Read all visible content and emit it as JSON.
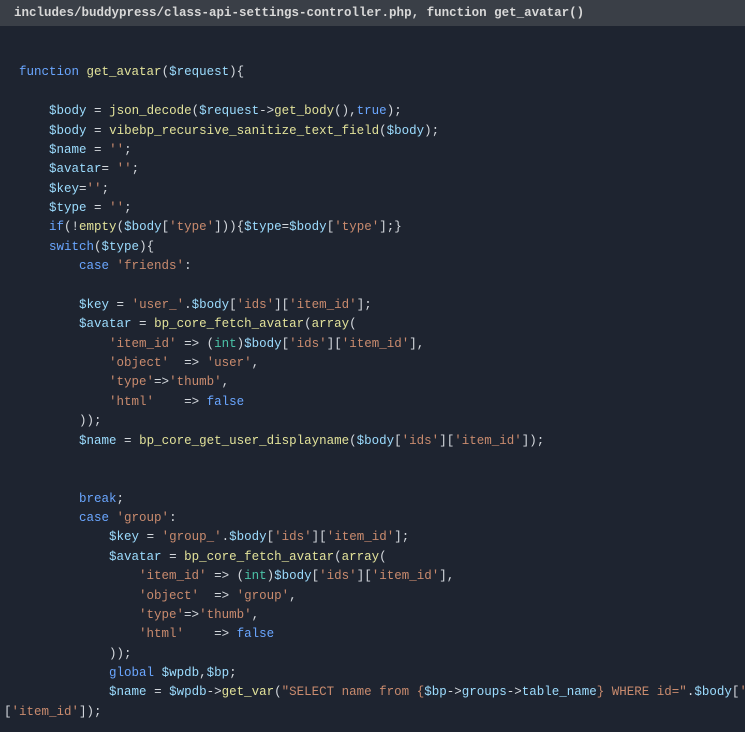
{
  "header": {
    "title": "includes/buddypress/class-api-settings-controller.php, function get_avatar()"
  },
  "code": {
    "line1_function": "function",
    "line1_name": "get_avatar",
    "line1_param": "$request",
    "body_var": "$body",
    "json_decode": "json_decode",
    "request_var": "$request",
    "get_body": "get_body",
    "true_kw": "true",
    "sanitize_fn": "vibebp_recursive_sanitize_text_field",
    "name_var": "$name",
    "avatar_var": "$avatar",
    "key_var": "$key",
    "type_var": "$type",
    "empty_str": "''",
    "empty_str2": "''",
    "if_kw": "if",
    "empty_fn": "empty",
    "type_key": "'type'",
    "switch_kw": "switch",
    "case_kw": "case",
    "friends_str": "'friends'",
    "user_prefix": "'user_'",
    "ids_key": "'ids'",
    "item_id_key": "'item_id'",
    "fetch_avatar": "bp_core_fetch_avatar",
    "array_fn": "array",
    "int_cast": "int",
    "object_key": "'object'",
    "user_str": "'user'",
    "type_key2": "'type'",
    "thumb_str": "'thumb'",
    "html_key": "'html'",
    "false_kw": "false",
    "arrow": "=>",
    "displayname_fn": "bp_core_get_user_displayname",
    "break_kw": "break",
    "group_str": "'group'",
    "group_prefix": "'group_'",
    "group_obj_str": "'group'",
    "global_kw": "global",
    "wpdb_var": "$wpdb",
    "bp_var": "$bp",
    "get_var": "get_var",
    "sql_part1": "\"SELECT name from ",
    "sql_interp_open": "{",
    "groups_prop": "groups",
    "table_name_prop": "table_name",
    "sql_interp_close": "}",
    "sql_part2": " WHERE id=\""
  }
}
